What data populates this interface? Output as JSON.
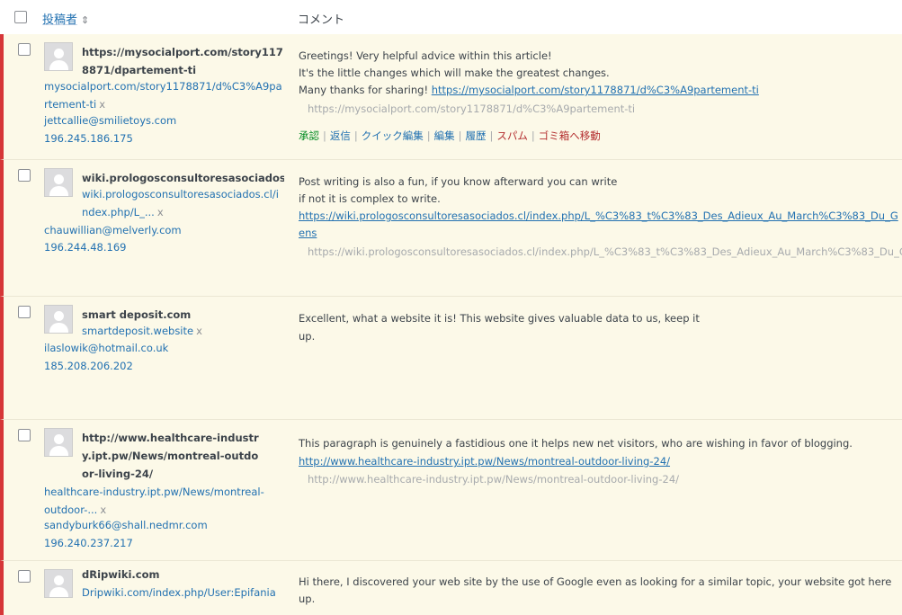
{
  "header": {
    "author_col": "投稿者",
    "comment_col": "コメント"
  },
  "actions": {
    "approve": "承認",
    "reply": "返信",
    "quick_edit": "クイック編集",
    "edit": "編集",
    "history": "履歴",
    "spam": "スパム",
    "trash": "ゴミ箱へ移動"
  },
  "comments": [
    {
      "author_name": "https://mysocialport.com/story1178871/dpartement-ti",
      "author_url": "mysocialport.com/story1178871/d%C3%A9partement-ti",
      "author_email": "jettcallie@smilietoys.com",
      "author_ip": "196.245.186.175",
      "text_lines": [
        "Greetings! Very helpful advice within this article!",
        "It's the little changes which will make the greatest changes."
      ],
      "text_prefix": "Many thanks for sharing! ",
      "link": "https://mysocialport.com/story1178871/d%C3%A9partement-ti",
      "gray_url": "https://mysocialport.com/story1178871/d%C3%A9partement-ti"
    },
    {
      "author_name": "wiki.prologosconsultoresasociados.cl",
      "author_url": "wiki.prologosconsultoresasociados.cl/index.php/L_...",
      "author_email": "chauwillian@melverly.com",
      "author_ip": "196.244.48.169",
      "text_lines": [
        "Post writing is also a fun, if you know afterward you can write",
        "if not it is complex to write."
      ],
      "link_line1": "https://wiki.prologosconsultoresasociados.cl/index.php/L_%C3%83_t%C3%83_Des_Adieux_Au_March%C3%83_Du_G",
      "link_line2": "ens",
      "gray_url": "https://wiki.prologosconsultoresasociados.cl/index.php/L_%C3%83_t%C3%83_Des_Adieux_Au_March%C3%83_Du_Ge"
    },
    {
      "author_name": "smart deposit.com",
      "author_url": "smartdeposit.website",
      "author_email": "ilaslowik@hotmail.co.uk",
      "author_ip": "185.208.206.202",
      "text_lines": [
        "Excellent, what a website it is! This website gives valuable data to us, keep it",
        "up."
      ]
    },
    {
      "author_name": "http://www.healthcare-industry.ipt.pw/News/montreal-outdoor-living-24/",
      "author_url": "healthcare-industry.ipt.pw/News/montreal-outdoor-...",
      "author_email": "sandyburk66@shall.nedmr.com",
      "author_ip": "196.240.237.217",
      "text_lines": [
        "This paragraph is genuinely a fastidious one it helps new net visitors, who are wishing in favor of blogging."
      ],
      "link": "http://www.healthcare-industry.ipt.pw/News/montreal-outdoor-living-24/",
      "gray_url": "http://www.healthcare-industry.ipt.pw/News/montreal-outdoor-living-24/"
    },
    {
      "author_name": "dRipwiki.com",
      "author_url": "Dripwiki.com/index.php/User:Epifania",
      "text_lines": [
        "Hi there, I discovered your web site by the use of Google even as looking for a similar topic, your website got here",
        "up."
      ]
    }
  ],
  "colors": {
    "unapproved_bg": "#fcf9e8",
    "unapproved_border": "#d63638",
    "link": "#2271b1",
    "approve": "#008a20",
    "danger": "#b32d2e"
  }
}
